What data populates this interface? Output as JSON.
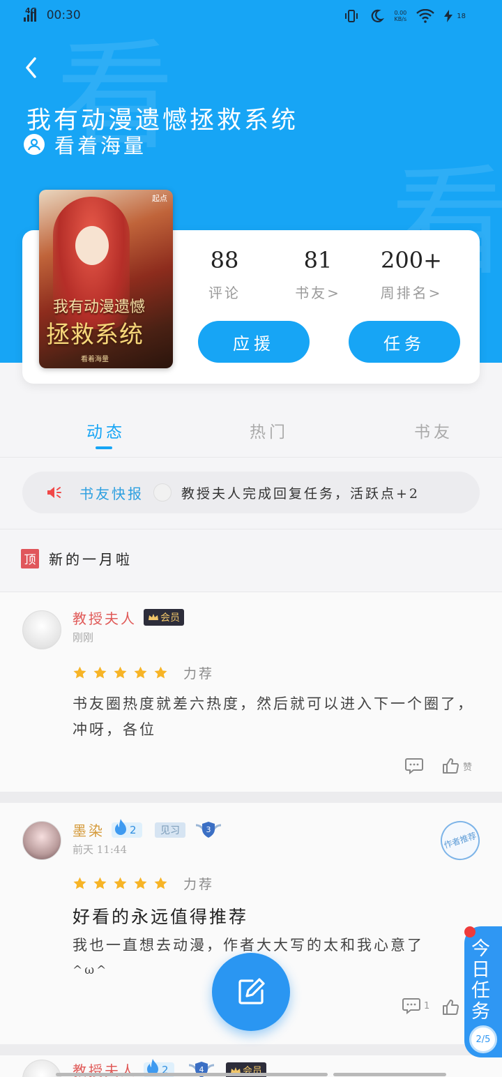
{
  "statusbar": {
    "network": "4G",
    "time": "00:30",
    "speed_top": "0.00",
    "speed_bottom": "KB/s",
    "battery": "18"
  },
  "book": {
    "title": "我有动漫遗憾拯救系统",
    "author": "看着海量",
    "cover_title_1": "我有动漫遗憾",
    "cover_title_2": "拯救系统",
    "cover_publisher": "看着海量",
    "cover_tag": "起点"
  },
  "watermark": "看",
  "stats": [
    {
      "value": "88",
      "label": "评论"
    },
    {
      "value": "81",
      "label": "书友>"
    },
    {
      "value": "200+",
      "label": "周排名>"
    }
  ],
  "buttons": {
    "support": "应援",
    "task": "任务"
  },
  "tabs": [
    {
      "label": "动态",
      "active": true
    },
    {
      "label": "热门",
      "active": false
    },
    {
      "label": "书友",
      "active": false
    }
  ],
  "news": {
    "label": "书友快报",
    "text": "教授夫人完成回复任务，活跃点+2"
  },
  "pinned": {
    "tag": "顶",
    "text": "新的一月啦"
  },
  "comments": [
    {
      "name": "教授夫人",
      "badge_vip": "会员",
      "time": "刚刚",
      "stars": 5,
      "rating_label": "力荐",
      "body": "书友圈热度就差六热度，然后就可以进入下一个圈了，冲呀，各位",
      "like_label": "赞"
    },
    {
      "name": "墨染",
      "level": "2",
      "trainee": "见习",
      "shield_level": "3",
      "time": "前天 11:44",
      "stamp": "作者推荐",
      "stars": 5,
      "rating_label": "力荐",
      "headline": "好看的永远值得推荐",
      "body": "我也一直想去动漫，作者大大写的太和我心意了",
      "body_line2": "^ω^",
      "reply_count": "1"
    },
    {
      "name": "教授夫人",
      "level": "2",
      "shield_level": "4",
      "badge_vip": "会员"
    }
  ],
  "task_float": {
    "label": "今日任务",
    "progress": "2/5"
  },
  "colors": {
    "primary": "#17a5f5",
    "accent_red": "#e05a58",
    "star": "#f7b426"
  },
  "icons": [
    "back-arrow-icon",
    "user-icon",
    "speaker-icon",
    "star-icon",
    "comment-icon",
    "thumbs-up-icon",
    "edit-icon",
    "flame-icon",
    "shield-icon",
    "crown-icon"
  ]
}
